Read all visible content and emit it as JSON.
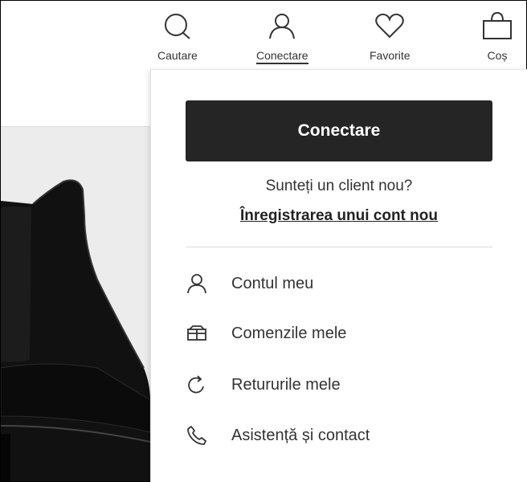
{
  "header": {
    "nav": [
      {
        "label": "Cautare",
        "icon": "search-icon"
      },
      {
        "label": "Conectare",
        "icon": "user-icon"
      },
      {
        "label": "Favorite",
        "icon": "heart-icon"
      },
      {
        "label": "Coș",
        "icon": "shopping-bag-icon"
      }
    ]
  },
  "account_menu": {
    "login_label": "Conectare",
    "new_client_text": "Sunteți un client nou?",
    "register_link": "Înregistrarea unui cont nou",
    "items": [
      {
        "label": "Contul meu",
        "icon": "user-icon"
      },
      {
        "label": "Comenzile mele",
        "icon": "package-icon"
      },
      {
        "label": "Retururile mele",
        "icon": "return-arrow-icon"
      },
      {
        "label": "Asistență și contact",
        "icon": "phone-icon"
      }
    ]
  },
  "colors": {
    "button_bg": "#252525",
    "text": "#333333",
    "product_bg": "#ececec"
  }
}
